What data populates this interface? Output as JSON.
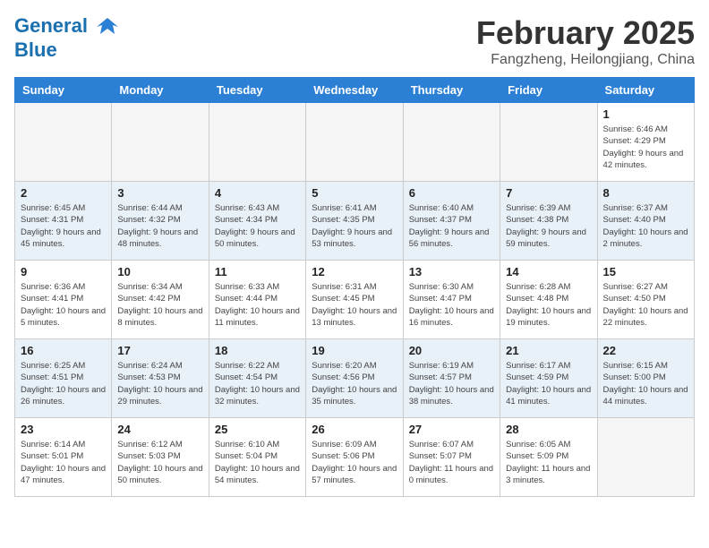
{
  "header": {
    "logo_line1": "General",
    "logo_line2": "Blue",
    "month_title": "February 2025",
    "location": "Fangzheng, Heilongjiang, China"
  },
  "weekdays": [
    "Sunday",
    "Monday",
    "Tuesday",
    "Wednesday",
    "Thursday",
    "Friday",
    "Saturday"
  ],
  "weeks": [
    [
      {
        "day": "",
        "info": ""
      },
      {
        "day": "",
        "info": ""
      },
      {
        "day": "",
        "info": ""
      },
      {
        "day": "",
        "info": ""
      },
      {
        "day": "",
        "info": ""
      },
      {
        "day": "",
        "info": ""
      },
      {
        "day": "1",
        "info": "Sunrise: 6:46 AM\nSunset: 4:29 PM\nDaylight: 9 hours and 42 minutes."
      }
    ],
    [
      {
        "day": "2",
        "info": "Sunrise: 6:45 AM\nSunset: 4:31 PM\nDaylight: 9 hours and 45 minutes."
      },
      {
        "day": "3",
        "info": "Sunrise: 6:44 AM\nSunset: 4:32 PM\nDaylight: 9 hours and 48 minutes."
      },
      {
        "day": "4",
        "info": "Sunrise: 6:43 AM\nSunset: 4:34 PM\nDaylight: 9 hours and 50 minutes."
      },
      {
        "day": "5",
        "info": "Sunrise: 6:41 AM\nSunset: 4:35 PM\nDaylight: 9 hours and 53 minutes."
      },
      {
        "day": "6",
        "info": "Sunrise: 6:40 AM\nSunset: 4:37 PM\nDaylight: 9 hours and 56 minutes."
      },
      {
        "day": "7",
        "info": "Sunrise: 6:39 AM\nSunset: 4:38 PM\nDaylight: 9 hours and 59 minutes."
      },
      {
        "day": "8",
        "info": "Sunrise: 6:37 AM\nSunset: 4:40 PM\nDaylight: 10 hours and 2 minutes."
      }
    ],
    [
      {
        "day": "9",
        "info": "Sunrise: 6:36 AM\nSunset: 4:41 PM\nDaylight: 10 hours and 5 minutes."
      },
      {
        "day": "10",
        "info": "Sunrise: 6:34 AM\nSunset: 4:42 PM\nDaylight: 10 hours and 8 minutes."
      },
      {
        "day": "11",
        "info": "Sunrise: 6:33 AM\nSunset: 4:44 PM\nDaylight: 10 hours and 11 minutes."
      },
      {
        "day": "12",
        "info": "Sunrise: 6:31 AM\nSunset: 4:45 PM\nDaylight: 10 hours and 13 minutes."
      },
      {
        "day": "13",
        "info": "Sunrise: 6:30 AM\nSunset: 4:47 PM\nDaylight: 10 hours and 16 minutes."
      },
      {
        "day": "14",
        "info": "Sunrise: 6:28 AM\nSunset: 4:48 PM\nDaylight: 10 hours and 19 minutes."
      },
      {
        "day": "15",
        "info": "Sunrise: 6:27 AM\nSunset: 4:50 PM\nDaylight: 10 hours and 22 minutes."
      }
    ],
    [
      {
        "day": "16",
        "info": "Sunrise: 6:25 AM\nSunset: 4:51 PM\nDaylight: 10 hours and 26 minutes."
      },
      {
        "day": "17",
        "info": "Sunrise: 6:24 AM\nSunset: 4:53 PM\nDaylight: 10 hours and 29 minutes."
      },
      {
        "day": "18",
        "info": "Sunrise: 6:22 AM\nSunset: 4:54 PM\nDaylight: 10 hours and 32 minutes."
      },
      {
        "day": "19",
        "info": "Sunrise: 6:20 AM\nSunset: 4:56 PM\nDaylight: 10 hours and 35 minutes."
      },
      {
        "day": "20",
        "info": "Sunrise: 6:19 AM\nSunset: 4:57 PM\nDaylight: 10 hours and 38 minutes."
      },
      {
        "day": "21",
        "info": "Sunrise: 6:17 AM\nSunset: 4:59 PM\nDaylight: 10 hours and 41 minutes."
      },
      {
        "day": "22",
        "info": "Sunrise: 6:15 AM\nSunset: 5:00 PM\nDaylight: 10 hours and 44 minutes."
      }
    ],
    [
      {
        "day": "23",
        "info": "Sunrise: 6:14 AM\nSunset: 5:01 PM\nDaylight: 10 hours and 47 minutes."
      },
      {
        "day": "24",
        "info": "Sunrise: 6:12 AM\nSunset: 5:03 PM\nDaylight: 10 hours and 50 minutes."
      },
      {
        "day": "25",
        "info": "Sunrise: 6:10 AM\nSunset: 5:04 PM\nDaylight: 10 hours and 54 minutes."
      },
      {
        "day": "26",
        "info": "Sunrise: 6:09 AM\nSunset: 5:06 PM\nDaylight: 10 hours and 57 minutes."
      },
      {
        "day": "27",
        "info": "Sunrise: 6:07 AM\nSunset: 5:07 PM\nDaylight: 11 hours and 0 minutes."
      },
      {
        "day": "28",
        "info": "Sunrise: 6:05 AM\nSunset: 5:09 PM\nDaylight: 11 hours and 3 minutes."
      },
      {
        "day": "",
        "info": ""
      }
    ]
  ]
}
